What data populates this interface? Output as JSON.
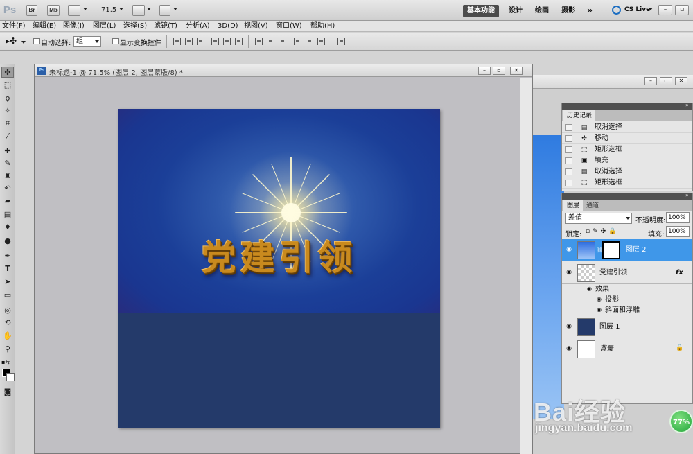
{
  "appbar": {
    "logo": "Ps",
    "bridge": "Br",
    "minibridge": "Mb",
    "zoom": "71.5",
    "workspaces": [
      "基本功能",
      "设计",
      "绘画",
      "摄影"
    ],
    "more": "»",
    "cslive": "CS Live"
  },
  "menu": [
    "文件(F)",
    "编辑(E)",
    "图像(I)",
    "图层(L)",
    "选择(S)",
    "滤镜(T)",
    "分析(A)",
    "3D(D)",
    "视图(V)",
    "窗口(W)",
    "帮助(H)"
  ],
  "options": {
    "auto_select_label": "自动选择:",
    "auto_select_value": "组",
    "show_transform_label": "显示变换控件"
  },
  "document": {
    "title": "未标题-1 @ 71.5% (图层 2, 图层蒙版/8) *",
    "headline": "党建引领"
  },
  "history": {
    "tab": "历史记录",
    "items": [
      {
        "icon": "document-icon",
        "label": "取消选择"
      },
      {
        "icon": "move-icon",
        "label": "移动"
      },
      {
        "icon": "marquee-icon",
        "label": "矩形选框"
      },
      {
        "icon": "fill-icon",
        "label": "填充"
      },
      {
        "icon": "document-icon",
        "label": "取消选择"
      },
      {
        "icon": "marquee-icon",
        "label": "矩形选框"
      }
    ]
  },
  "layers": {
    "tabs": [
      "图层",
      "通道"
    ],
    "blend_mode": "差值",
    "opacity_label": "不透明度:",
    "opacity": "100%",
    "lock_label": "锁定:",
    "fill_label": "填充:",
    "fill": "100%",
    "items": [
      {
        "name": "图层 2",
        "selected": true
      },
      {
        "name": "党建引领",
        "fx": "fx"
      },
      {
        "name": "效果"
      },
      {
        "name": "投影"
      },
      {
        "name": "斜面和浮雕"
      },
      {
        "name": "图层 1"
      },
      {
        "name": "背景"
      }
    ]
  },
  "watermark": {
    "logo": "Bai经验",
    "url": "jingyan.baidu.com",
    "badge": "77%"
  },
  "colors": {
    "selected_layer": "#3f97e9",
    "canvas_sky": "#1b3f98",
    "canvas_ground": "#243a6a",
    "headline": "#c98a1e"
  }
}
